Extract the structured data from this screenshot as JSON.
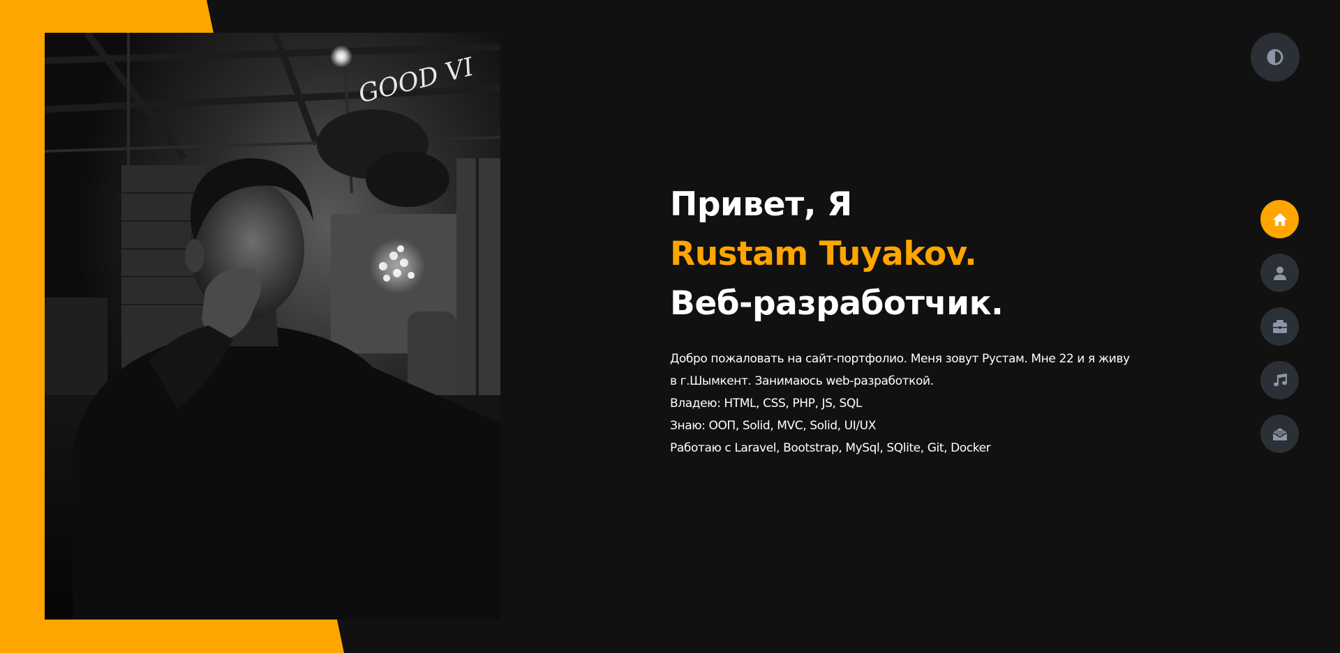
{
  "colors": {
    "background": "#111111",
    "accent": "#ffa500",
    "nav_button_bg": "#2b2f36",
    "nav_icon": "#8c96a6",
    "text": "#ffffff"
  },
  "theme_toggle": {
    "icon": "contrast-icon"
  },
  "hero": {
    "greeting": "Привет, Я",
    "name": "Rustam Tuyakov.",
    "role": "Веб-разработчик.",
    "about": [
      "Добро пожаловать на сайт-портфолио. Меня зовут Рустам. Мне 22 и я живу в г.Шымкент. Занимаюсь web-разработкой.",
      "Владею: HTML, CSS, PHP, JS, SQL",
      "Знаю: ООП, Solid, MVC, Solid, UI/UX",
      "Работаю с Laravel, Bootstrap, MySql, SQlite, Git, Docker"
    ]
  },
  "photo": {
    "neon_sign": "GOOD VI",
    "description": "black-and-white portrait photo"
  },
  "nav": [
    {
      "icon": "home-icon",
      "active": true
    },
    {
      "icon": "user-icon",
      "active": false
    },
    {
      "icon": "briefcase-icon",
      "active": false
    },
    {
      "icon": "music-icon",
      "active": false
    },
    {
      "icon": "envelope-open-icon",
      "active": false
    }
  ]
}
